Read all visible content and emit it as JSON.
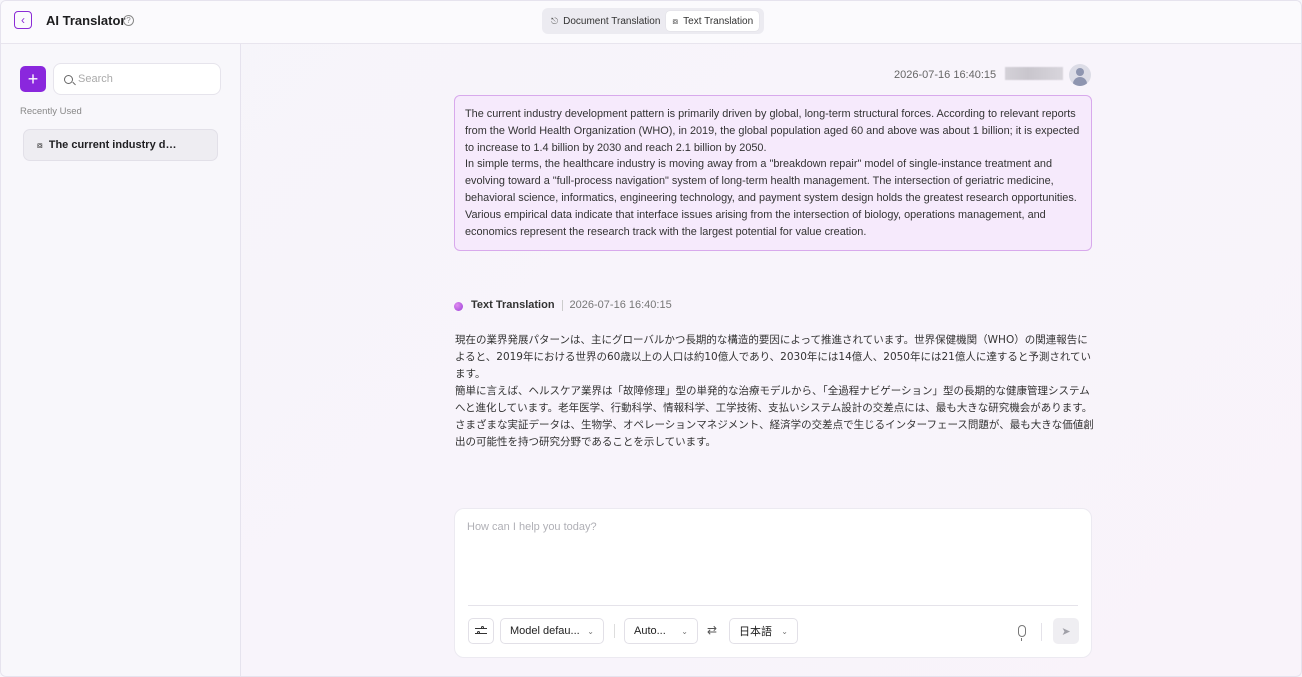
{
  "header": {
    "title": "AI Translator",
    "help_icon": "question-circle-icon",
    "back_icon": "chevron-left-icon",
    "tabs": [
      {
        "label": "Document Translation",
        "icon": "document-icon",
        "active": false
      },
      {
        "label": "Text Translation",
        "icon": "translate-icon",
        "active": true
      }
    ]
  },
  "sidebar": {
    "new_button": "+",
    "search_placeholder": "Search",
    "recent_label": "Recently Used",
    "history": [
      {
        "label": "The current industry dev...",
        "icon": "translate-icon"
      }
    ]
  },
  "conversation": {
    "source": {
      "timestamp": "2026-07-16 16:40:15",
      "paragraphs": [
        "The current industry development pattern is primarily driven by global, long-term structural forces. According to relevant reports from the World Health Organization (WHO), in 2019, the global population aged 60 and above was about 1 billion; it is expected to increase to 1.4 billion by 2030 and reach 2.1 billion by 2050.",
        "In simple terms, the healthcare industry is moving away from a \"breakdown repair\" model of single-instance treatment and evolving toward a \"full-process navigation\" system of long-term health management. The intersection of geriatric medicine, behavioral science, informatics, engineering technology, and payment system design holds the greatest research opportunities. Various empirical data indicate that interface issues arising from the intersection of biology, operations management, and economics represent the research track with the largest potential for value creation."
      ]
    },
    "result": {
      "title": "Text Translation",
      "timestamp": "2026-07-16 16:40:15",
      "paragraphs": [
        "現在の業界発展パターンは、主にグローバルかつ長期的な構造的要因によって推進されています。世界保健機関（WHO）の関連報告によると、2019年における世界の60歳以上の人口は約10億人であり、2030年には14億人、2050年には21億人に達すると予測されています。",
        "簡単に言えば、ヘルスケア業界は「故障修理」型の単発的な治療モデルから、「全過程ナビゲーション」型の長期的な健康管理システムへと進化しています。老年医学、行動科学、情報科学、工学技術、支払いシステム設計の交差点には、最も大きな研究機会があります。さまざまな実証データは、生物学、オペレーションマネジメント、経済学の交差点で生じるインターフェース問題が、最も大きな価値創出の可能性を持つ研究分野であることを示しています。"
      ]
    }
  },
  "composer": {
    "placeholder": "How can I help you today?",
    "model_label": "Model defau...",
    "source_lang": "Auto...",
    "target_lang": "日本語",
    "swap_icon": "swap-arrows-icon",
    "mic_icon": "microphone-icon",
    "send_icon": "send-icon",
    "settings_icon": "sliders-icon"
  },
  "colors": {
    "accent": "#8a27dd",
    "source_bubble_bg": "#f6eafc",
    "source_bubble_border": "#d8a9ec"
  }
}
